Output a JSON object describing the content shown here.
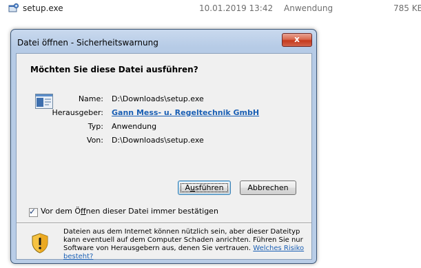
{
  "file_row": {
    "name": "setup.exe",
    "date": "10.01.2019 13:42",
    "type": "Anwendung",
    "size": "785 KB",
    "icon": "setup-exe-icon"
  },
  "dialog": {
    "title": "Datei öffnen - Sicherheitswarnung",
    "close_label": "x",
    "heading": "Möchten Sie diese Datei ausführen?",
    "app_icon": "application-window-icon",
    "fields": [
      {
        "label": "Name:",
        "value": "D:\\Downloads\\setup.exe"
      },
      {
        "label": "Herausgeber:",
        "value": "Gann Mess- u. Regeltechnik GmbH"
      },
      {
        "label": "Typ:",
        "value": "Anwendung"
      },
      {
        "label": "Von:",
        "value": "D:\\Downloads\\setup.exe"
      }
    ],
    "run_button": {
      "before": "A",
      "accel": "u",
      "after": "sführen"
    },
    "cancel_button": "Abbrechen",
    "checkbox": {
      "checked": true,
      "before": "Vor dem Ö",
      "accel": "f",
      "after": "fnen dieser Datei immer bestätigen"
    },
    "warning_icon": "security-shield-warning-icon",
    "warning_text": "Dateien aus dem Internet können nützlich sein, aber dieser Dateityp kann eventuell auf dem Computer Schaden anrichten. Führen Sie nur Software von Herausgebern aus, denen Sie vertrauen.",
    "warning_link": "Welches Risiko besteht?"
  },
  "colors": {
    "frame": "#b9cde7",
    "link": "#1a5fb4",
    "close": "#c5391c"
  }
}
